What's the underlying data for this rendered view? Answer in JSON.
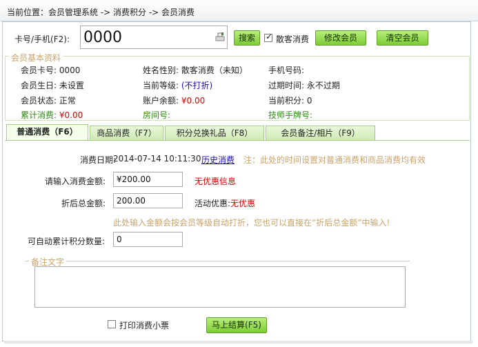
{
  "breadcrumb": {
    "label": "当前位置：",
    "path": "会员管理系统 -> 消费积分 -> 会员消费"
  },
  "card": {
    "label": "卡号/手机(F2):",
    "value": "0000",
    "icon": "card-reader-icon"
  },
  "toolbar": {
    "search": "搜索",
    "walkin_label": "散客消费",
    "walkin_checked": true,
    "edit_member": "修改会员",
    "clear_member": "清空会员"
  },
  "member": {
    "legend": "会员基本资料",
    "card_no_label": "会员卡号:",
    "card_no": "0000",
    "name_gender_label": "姓名性别:",
    "name_gender": "散客消费（未知）",
    "phone_label": "手机号码:",
    "phone": "",
    "birthday_label": "会员生日:",
    "birthday": "未设置",
    "level_label": "当前等级:",
    "level": "(不打折)",
    "expiry_label": "过期时间:",
    "expiry": "永不过期",
    "status_label": "会员状态:",
    "status": "正常",
    "balance_label": "账户余额:",
    "balance": "¥0.00",
    "points_label": "当前积分:",
    "points": "0",
    "total_label": "累计消费:",
    "total": "¥0.00",
    "room_label": "房间号:",
    "room": "",
    "tech_label": "技师手牌号:",
    "tech": ""
  },
  "tabs": [
    {
      "label": "普通消费（F6）",
      "active": true
    },
    {
      "label": "商品消费（F7）",
      "active": false
    },
    {
      "label": "积分兑换礼品（F8）",
      "active": false
    },
    {
      "label": "会员备注/相片（F9）",
      "active": false
    }
  ],
  "form": {
    "date_label": "消费日期:",
    "date_value": "2014-07-14 10:11:30",
    "history_link": "历史消费",
    "date_note": "注：此处的时间设置对普通消费和商品消费均有效",
    "amount_label": "请输入消费金额:",
    "amount_value": "¥200.00",
    "no_discount_info": "无优惠信息",
    "total_label": "折后总金额:",
    "total_value": "200.00",
    "promo_label": "活动优惠:",
    "promo_value": "无优惠",
    "hint": "此处输入金额会按会员等级自动打折，您也可以直接在“折后总金额”中输入!",
    "points_label": "可自动累计积分数量:",
    "points_value": "0",
    "remark_legend": "备注文字",
    "remark_value": "",
    "print_label": "打印消费小票",
    "print_checked": false,
    "settle_button": "马上结算(F5)"
  }
}
